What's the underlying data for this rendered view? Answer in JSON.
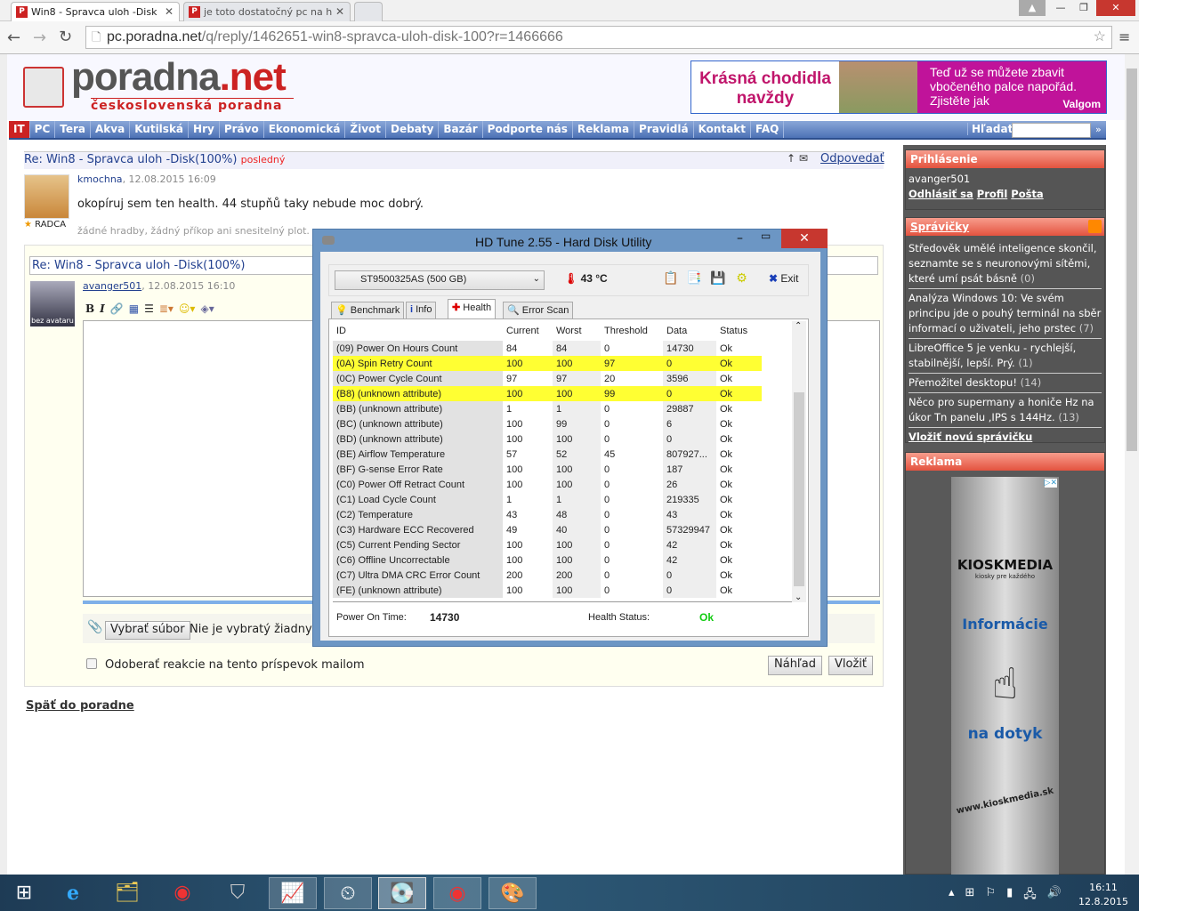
{
  "browser": {
    "tabs": [
      {
        "title": "Win8 - Spravca uloh -Disk",
        "favicon": "PNET"
      },
      {
        "title": "je toto dostatočný pc na h",
        "favicon": "PNET"
      }
    ],
    "url_host": "pc.poradna.net",
    "url_path": "/q/reply/1462651-win8-spravca-uloh-disk-100?r=1466666"
  },
  "site": {
    "logo_main": "poradna",
    "logo_tld": ".net",
    "logo_sub": "československá poradna",
    "ad_top": {
      "headline": "Krásná chodidla navždy",
      "text": "Teď už se můžete zbavit vbočeného palce napořád. Zjistěte jak",
      "brand": "Valgom"
    },
    "nav": [
      "IT",
      "PC",
      "Tera",
      "Akva",
      "Kutilská",
      "Hry",
      "Právo",
      "Ekonomická",
      "Život",
      "Debaty",
      "Bazár",
      "Podporte nás",
      "Reklama",
      "Pravidlá",
      "Kontakt",
      "FAQ"
    ],
    "search_label": "Hľadať:",
    "search_go": "»"
  },
  "post": {
    "title": "Re: Win8 - Spravca uloh -Disk(100%)",
    "badge": "posledný",
    "reply": "Odpovedať",
    "author": "kmochna",
    "date": ", 12.08.2015 16:09",
    "rank": "RADCA",
    "text": "okopíruj sem ten health. 44 stupňů taky nebude moc dobrý.",
    "signature": "žádné hradby, žádný příkop ani snesitelný plot."
  },
  "form": {
    "subject": "Re: Win8 - Spravca uloh -Disk(100%)",
    "avatar_label": "bez avataru",
    "author": "avanger501",
    "date": ", 12.08.2015 16:10",
    "file_button": "Vybrať súbor",
    "file_none": "Nie je vybratý žiadny",
    "subscribe": "Odoberať reakcie na tento príspevok mailom",
    "preview": "Náhľad",
    "submit": "Vložiť",
    "back": "Späť do poradne"
  },
  "sidebar": {
    "login": {
      "title": "Prihlásenie",
      "user": "avanger501",
      "links": [
        "Odhlásiť sa",
        "Profil",
        "Pošta"
      ]
    },
    "news": {
      "title": "Správičky",
      "items": [
        {
          "text": "Středověk umělé inteligence skončil, seznamte se s neuronovými sítěmi, které umí psát básně",
          "count": "(0)"
        },
        {
          "text": "Analýza Windows 10: Ve svém principu jde o pouhý terminál na sběr informací o uživateli, jeho prstec",
          "count": "(7)"
        },
        {
          "text": "LibreOffice 5 je venku - rychlejší, stabilnější, lepší. Prý.",
          "count": "(1)"
        },
        {
          "text": "Přemožitel desktopu!",
          "count": "(14)"
        },
        {
          "text": "Něco pro supermany a honiče Hz na úkor Tn panelu ,IPS s 144Hz.",
          "count": "(13)"
        }
      ],
      "add": "Vložiť novú správičku"
    },
    "ads": {
      "title": "Reklama",
      "brand": "KIOSKMEDIA",
      "tagline": "kiosky pre každého",
      "l1": "Informácie",
      "l2": "na dotyk",
      "url": "www.kioskmedia.sk"
    }
  },
  "hdtune": {
    "title": "HD Tune 2.55 - Hard Disk Utility",
    "drive": "ST9500325AS (500 GB)",
    "temperature": "43 °C",
    "exit": "Exit",
    "tabs": [
      "Benchmark",
      "Info",
      "Health",
      "Error Scan"
    ],
    "active_tab": "Health",
    "columns": [
      "ID",
      "Current",
      "Worst",
      "Threshold",
      "Data",
      "Status"
    ],
    "rows": [
      {
        "c": [
          "(09) Power On Hours Count",
          "84",
          "84",
          "0",
          "14730",
          "Ok"
        ],
        "hl": false
      },
      {
        "c": [
          "(0A) Spin Retry Count",
          "100",
          "100",
          "97",
          "0",
          "Ok"
        ],
        "hl": true
      },
      {
        "c": [
          "(0C) Power Cycle Count",
          "97",
          "97",
          "20",
          "3596",
          "Ok"
        ],
        "hl": false
      },
      {
        "c": [
          "(B8) (unknown attribute)",
          "100",
          "100",
          "99",
          "0",
          "Ok"
        ],
        "hl": true
      },
      {
        "c": [
          "(BB) (unknown attribute)",
          "1",
          "1",
          "0",
          "29887",
          "Ok"
        ],
        "hl": false
      },
      {
        "c": [
          "(BC) (unknown attribute)",
          "100",
          "99",
          "0",
          "6",
          "Ok"
        ],
        "hl": false
      },
      {
        "c": [
          "(BD) (unknown attribute)",
          "100",
          "100",
          "0",
          "0",
          "Ok"
        ],
        "hl": false
      },
      {
        "c": [
          "(BE) Airflow Temperature",
          "57",
          "52",
          "45",
          "807927...",
          "Ok"
        ],
        "hl": false
      },
      {
        "c": [
          "(BF) G-sense Error Rate",
          "100",
          "100",
          "0",
          "187",
          "Ok"
        ],
        "hl": false
      },
      {
        "c": [
          "(C0) Power Off Retract Count",
          "100",
          "100",
          "0",
          "26",
          "Ok"
        ],
        "hl": false
      },
      {
        "c": [
          "(C1) Load Cycle Count",
          "1",
          "1",
          "0",
          "219335",
          "Ok"
        ],
        "hl": false
      },
      {
        "c": [
          "(C2) Temperature",
          "43",
          "48",
          "0",
          "43",
          "Ok"
        ],
        "hl": false
      },
      {
        "c": [
          "(C3) Hardware ECC Recovered",
          "49",
          "40",
          "0",
          "57329947",
          "Ok"
        ],
        "hl": false
      },
      {
        "c": [
          "(C5) Current Pending Sector",
          "100",
          "100",
          "0",
          "42",
          "Ok"
        ],
        "hl": false
      },
      {
        "c": [
          "(C6) Offline Uncorrectable",
          "100",
          "100",
          "0",
          "42",
          "Ok"
        ],
        "hl": false
      },
      {
        "c": [
          "(C7) Ultra DMA CRC Error Count",
          "200",
          "200",
          "0",
          "0",
          "Ok"
        ],
        "hl": false
      },
      {
        "c": [
          "(FE) (unknown attribute)",
          "100",
          "100",
          "0",
          "0",
          "Ok"
        ],
        "hl": false
      }
    ],
    "power_on_label": "Power On Time:",
    "power_on_value": "14730",
    "health_label": "Health Status:",
    "health_value": "Ok"
  },
  "taskbar": {
    "time": "16:11",
    "date": "12.8.2015"
  }
}
